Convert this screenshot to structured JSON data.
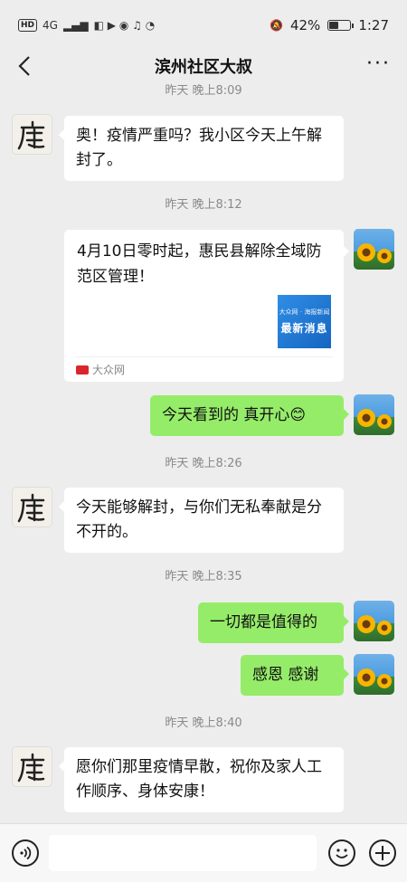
{
  "status_bar": {
    "network": "4G",
    "battery": "42%",
    "battery_level": 0.42,
    "time": "1:27"
  },
  "header": {
    "title": "滨州社区大叔",
    "back_icon": "chevron-left-icon",
    "more_label": "···"
  },
  "messages": {
    "ts0": "昨天 晚上8:09",
    "m1": "奥！疫情严重吗？我小区今天上午解封了。",
    "ts1": "昨天 晚上8:12",
    "card": {
      "title": "4月10日零时起，惠民县解除全域防范区管理！",
      "thumb_top": "大众网 · 海报新闻",
      "thumb_text": "最新消息",
      "source": "大众网"
    },
    "m2": "今天看到的  真开心😊",
    "ts2": "昨天 晚上8:26",
    "m3": "今天能够解封，与你们无私奉献是分不开的。",
    "ts3": "昨天 晚上8:35",
    "m4": "一切都是值得的",
    "m5": "感恩  感谢",
    "ts4": "昨天 晚上8:40",
    "m6": "愿你们那里疫情早散，祝你及家人工作顺序、身体安康！"
  },
  "input_bar": {
    "placeholder": "",
    "voice_icon": "voice-icon",
    "emoji_icon": "emoji-icon",
    "plus_icon": "plus-icon"
  },
  "colors": {
    "background": "#ededed",
    "own_bubble": "#95ec69",
    "other_bubble": "#ffffff"
  }
}
